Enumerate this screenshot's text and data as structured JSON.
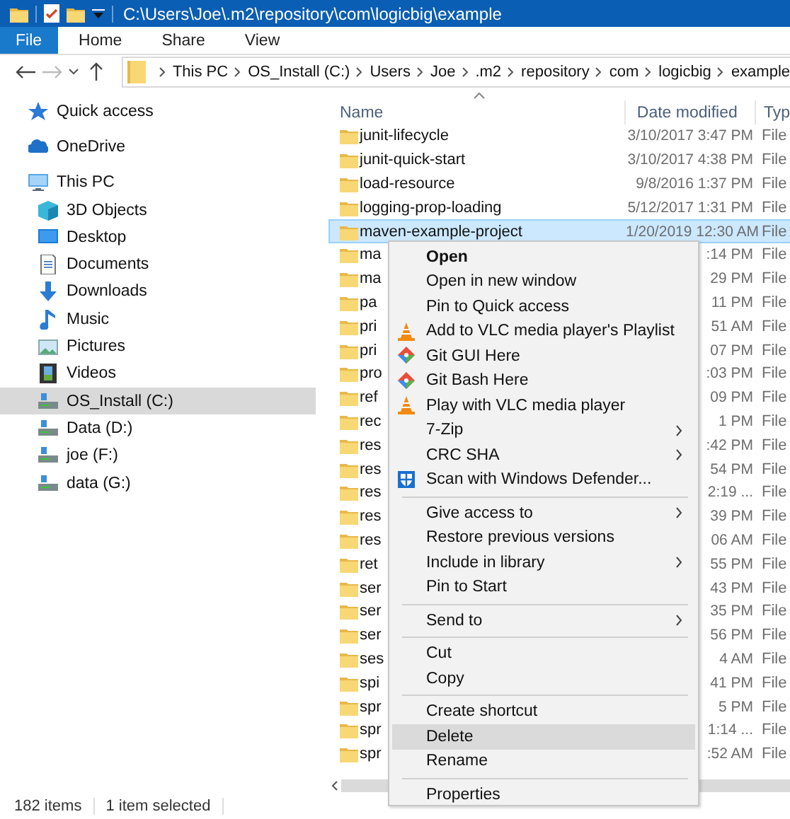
{
  "title_bar": {
    "title": "C:\\Users\\Joe\\.m2\\repository\\com\\logicbig\\example"
  },
  "ribbon": {
    "tabs": [
      {
        "label": "File",
        "selected": true
      },
      {
        "label": "Home",
        "selected": false
      },
      {
        "label": "Share",
        "selected": false
      },
      {
        "label": "View",
        "selected": false
      }
    ]
  },
  "address_bar": {
    "segments": [
      "This PC",
      "OS_Install (C:)",
      "Users",
      "Joe",
      ".m2",
      "repository",
      "com",
      "logicbig",
      "example"
    ]
  },
  "nav_pane": {
    "items": [
      {
        "label": "Quick access",
        "selected": false
      },
      {
        "label": "OneDrive",
        "selected": false
      },
      {
        "label": "This PC",
        "selected": false,
        "children": [
          {
            "label": "3D Objects",
            "selected": false
          },
          {
            "label": "Desktop",
            "selected": false
          },
          {
            "label": "Documents",
            "selected": false
          },
          {
            "label": "Downloads",
            "selected": false
          },
          {
            "label": "Music",
            "selected": false
          },
          {
            "label": "Pictures",
            "selected": false
          },
          {
            "label": "Videos",
            "selected": false
          },
          {
            "label": "OS_Install (C:)",
            "selected": true
          },
          {
            "label": "Data (D:)",
            "selected": false
          },
          {
            "label": "joe (F:)",
            "selected": false
          },
          {
            "label": "data (G:)",
            "selected": false
          }
        ]
      }
    ]
  },
  "file_list": {
    "columns": [
      "Name",
      "Date modified",
      "Typ"
    ],
    "rows": [
      {
        "name": "junit-lifecycle",
        "date": "3/10/2017 3:47 PM",
        "type": "File",
        "selected": false
      },
      {
        "name": "junit-quick-start",
        "date": "3/10/2017 4:38 PM",
        "type": "File",
        "selected": false
      },
      {
        "name": "load-resource",
        "date": "9/8/2016 1:37 PM",
        "type": "File",
        "selected": false
      },
      {
        "name": "logging-prop-loading",
        "date": "5/12/2017 1:31 PM",
        "type": "File",
        "selected": false
      },
      {
        "name": "maven-example-project",
        "date": "1/20/2019 12:30 AM",
        "type": "File",
        "selected": true
      },
      {
        "name": "ma",
        "date": ":14 PM",
        "type": "File",
        "selected": false
      },
      {
        "name": "ma",
        "date": "29 PM",
        "type": "File",
        "selected": false
      },
      {
        "name": "pa",
        "date": "11 PM",
        "type": "File",
        "selected": false
      },
      {
        "name": "pri",
        "date": "51 AM",
        "type": "File",
        "selected": false
      },
      {
        "name": "pri",
        "date": "07 PM",
        "type": "File",
        "selected": false
      },
      {
        "name": "pro",
        "date": ":03 PM",
        "type": "File",
        "selected": false
      },
      {
        "name": "ref",
        "date": "09 PM",
        "type": "File",
        "selected": false
      },
      {
        "name": "rec",
        "date": "1 PM",
        "type": "File",
        "selected": false
      },
      {
        "name": "res",
        "date": ":42 PM",
        "type": "File",
        "selected": false
      },
      {
        "name": "res",
        "date": "54 PM",
        "type": "File",
        "selected": false
      },
      {
        "name": "res",
        "date": "2:19 ...",
        "type": "File",
        "selected": false
      },
      {
        "name": "res",
        "date": "39 PM",
        "type": "File",
        "selected": false
      },
      {
        "name": "res",
        "date": "06 AM",
        "type": "File",
        "selected": false
      },
      {
        "name": "ret",
        "date": "55 PM",
        "type": "File",
        "selected": false
      },
      {
        "name": "ser",
        "date": "43 PM",
        "type": "File",
        "selected": false
      },
      {
        "name": "ser",
        "date": "35 PM",
        "type": "File",
        "selected": false
      },
      {
        "name": "ser",
        "date": "56 PM",
        "type": "File",
        "selected": false
      },
      {
        "name": "ses",
        "date": "4 AM",
        "type": "File",
        "selected": false
      },
      {
        "name": "spi",
        "date": "41 PM",
        "type": "File",
        "selected": false
      },
      {
        "name": "spr",
        "date": "5 PM",
        "type": "File",
        "selected": false
      },
      {
        "name": "spr",
        "date": "1:14 ...",
        "type": "File",
        "selected": false
      },
      {
        "name": "spr",
        "date": ":52 AM",
        "type": "File",
        "selected": false
      }
    ]
  },
  "context_menu": {
    "items": [
      {
        "kind": "item",
        "label": "Open",
        "default": true,
        "submenu": false,
        "selected": false
      },
      {
        "kind": "item",
        "label": "Open in new window",
        "default": false,
        "submenu": false,
        "selected": false
      },
      {
        "kind": "item",
        "label": "Pin to Quick access",
        "default": false,
        "submenu": false,
        "selected": false
      },
      {
        "kind": "item",
        "label": "Add to VLC media player's Playlist",
        "default": false,
        "submenu": false,
        "selected": false
      },
      {
        "kind": "item",
        "label": "Git GUI Here",
        "default": false,
        "submenu": false,
        "selected": false
      },
      {
        "kind": "item",
        "label": "Git Bash Here",
        "default": false,
        "submenu": false,
        "selected": false
      },
      {
        "kind": "item",
        "label": "Play with VLC media player",
        "default": false,
        "submenu": false,
        "selected": false
      },
      {
        "kind": "item",
        "label": "7-Zip",
        "default": false,
        "submenu": true,
        "selected": false
      },
      {
        "kind": "item",
        "label": "CRC SHA",
        "default": false,
        "submenu": true,
        "selected": false
      },
      {
        "kind": "item",
        "label": "Scan with Windows Defender...",
        "default": false,
        "submenu": false,
        "selected": false
      },
      {
        "kind": "separator"
      },
      {
        "kind": "item",
        "label": "Give access to",
        "default": false,
        "submenu": true,
        "selected": false
      },
      {
        "kind": "item",
        "label": "Restore previous versions",
        "default": false,
        "submenu": false,
        "selected": false
      },
      {
        "kind": "item",
        "label": "Include in library",
        "default": false,
        "submenu": true,
        "selected": false
      },
      {
        "kind": "item",
        "label": "Pin to Start",
        "default": false,
        "submenu": false,
        "selected": false
      },
      {
        "kind": "separator"
      },
      {
        "kind": "item",
        "label": "Send to",
        "default": false,
        "submenu": true,
        "selected": false
      },
      {
        "kind": "separator"
      },
      {
        "kind": "item",
        "label": "Cut",
        "default": false,
        "submenu": false,
        "selected": false
      },
      {
        "kind": "item",
        "label": "Copy",
        "default": false,
        "submenu": false,
        "selected": false
      },
      {
        "kind": "separator"
      },
      {
        "kind": "item",
        "label": "Create shortcut",
        "default": false,
        "submenu": false,
        "selected": false
      },
      {
        "kind": "item",
        "label": "Delete",
        "default": false,
        "submenu": false,
        "selected": true
      },
      {
        "kind": "item",
        "label": "Rename",
        "default": false,
        "submenu": false,
        "selected": false
      },
      {
        "kind": "separator"
      },
      {
        "kind": "item",
        "label": "Properties",
        "default": false,
        "submenu": false,
        "selected": false
      }
    ]
  },
  "status_bar": {
    "item_count": "182 items",
    "selection": "1 item selected"
  }
}
